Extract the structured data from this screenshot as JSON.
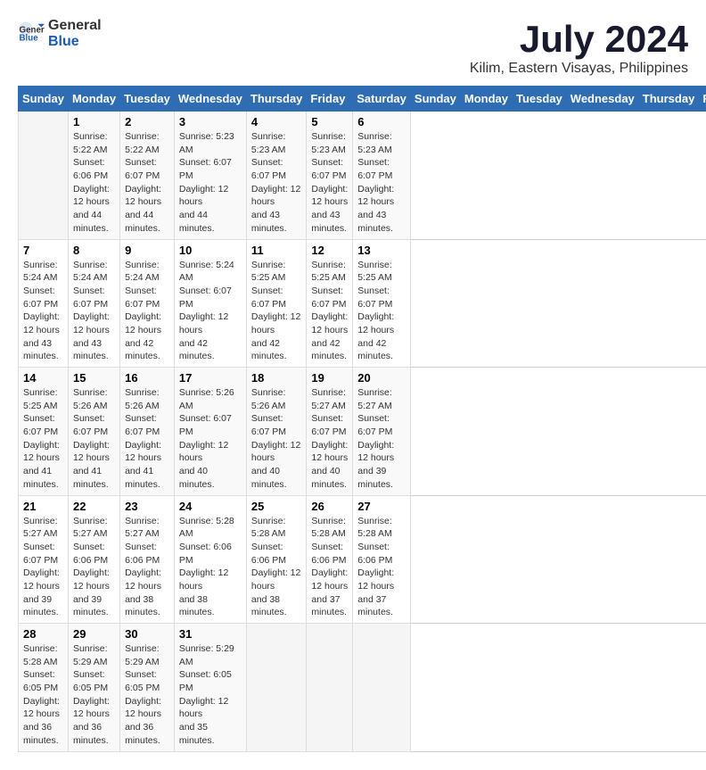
{
  "header": {
    "logo_general": "General",
    "logo_blue": "Blue",
    "month_year": "July 2024",
    "location": "Kilim, Eastern Visayas, Philippines"
  },
  "calendar": {
    "days_of_week": [
      "Sunday",
      "Monday",
      "Tuesday",
      "Wednesday",
      "Thursday",
      "Friday",
      "Saturday"
    ],
    "weeks": [
      [
        {
          "day": "",
          "info": ""
        },
        {
          "day": "1",
          "info": "Sunrise: 5:22 AM\nSunset: 6:06 PM\nDaylight: 12 hours\nand 44 minutes."
        },
        {
          "day": "2",
          "info": "Sunrise: 5:22 AM\nSunset: 6:07 PM\nDaylight: 12 hours\nand 44 minutes."
        },
        {
          "day": "3",
          "info": "Sunrise: 5:23 AM\nSunset: 6:07 PM\nDaylight: 12 hours\nand 44 minutes."
        },
        {
          "day": "4",
          "info": "Sunrise: 5:23 AM\nSunset: 6:07 PM\nDaylight: 12 hours\nand 43 minutes."
        },
        {
          "day": "5",
          "info": "Sunrise: 5:23 AM\nSunset: 6:07 PM\nDaylight: 12 hours\nand 43 minutes."
        },
        {
          "day": "6",
          "info": "Sunrise: 5:23 AM\nSunset: 6:07 PM\nDaylight: 12 hours\nand 43 minutes."
        }
      ],
      [
        {
          "day": "7",
          "info": "Sunrise: 5:24 AM\nSunset: 6:07 PM\nDaylight: 12 hours\nand 43 minutes."
        },
        {
          "day": "8",
          "info": "Sunrise: 5:24 AM\nSunset: 6:07 PM\nDaylight: 12 hours\nand 43 minutes."
        },
        {
          "day": "9",
          "info": "Sunrise: 5:24 AM\nSunset: 6:07 PM\nDaylight: 12 hours\nand 42 minutes."
        },
        {
          "day": "10",
          "info": "Sunrise: 5:24 AM\nSunset: 6:07 PM\nDaylight: 12 hours\nand 42 minutes."
        },
        {
          "day": "11",
          "info": "Sunrise: 5:25 AM\nSunset: 6:07 PM\nDaylight: 12 hours\nand 42 minutes."
        },
        {
          "day": "12",
          "info": "Sunrise: 5:25 AM\nSunset: 6:07 PM\nDaylight: 12 hours\nand 42 minutes."
        },
        {
          "day": "13",
          "info": "Sunrise: 5:25 AM\nSunset: 6:07 PM\nDaylight: 12 hours\nand 42 minutes."
        }
      ],
      [
        {
          "day": "14",
          "info": "Sunrise: 5:25 AM\nSunset: 6:07 PM\nDaylight: 12 hours\nand 41 minutes."
        },
        {
          "day": "15",
          "info": "Sunrise: 5:26 AM\nSunset: 6:07 PM\nDaylight: 12 hours\nand 41 minutes."
        },
        {
          "day": "16",
          "info": "Sunrise: 5:26 AM\nSunset: 6:07 PM\nDaylight: 12 hours\nand 41 minutes."
        },
        {
          "day": "17",
          "info": "Sunrise: 5:26 AM\nSunset: 6:07 PM\nDaylight: 12 hours\nand 40 minutes."
        },
        {
          "day": "18",
          "info": "Sunrise: 5:26 AM\nSunset: 6:07 PM\nDaylight: 12 hours\nand 40 minutes."
        },
        {
          "day": "19",
          "info": "Sunrise: 5:27 AM\nSunset: 6:07 PM\nDaylight: 12 hours\nand 40 minutes."
        },
        {
          "day": "20",
          "info": "Sunrise: 5:27 AM\nSunset: 6:07 PM\nDaylight: 12 hours\nand 39 minutes."
        }
      ],
      [
        {
          "day": "21",
          "info": "Sunrise: 5:27 AM\nSunset: 6:07 PM\nDaylight: 12 hours\nand 39 minutes."
        },
        {
          "day": "22",
          "info": "Sunrise: 5:27 AM\nSunset: 6:06 PM\nDaylight: 12 hours\nand 39 minutes."
        },
        {
          "day": "23",
          "info": "Sunrise: 5:27 AM\nSunset: 6:06 PM\nDaylight: 12 hours\nand 38 minutes."
        },
        {
          "day": "24",
          "info": "Sunrise: 5:28 AM\nSunset: 6:06 PM\nDaylight: 12 hours\nand 38 minutes."
        },
        {
          "day": "25",
          "info": "Sunrise: 5:28 AM\nSunset: 6:06 PM\nDaylight: 12 hours\nand 38 minutes."
        },
        {
          "day": "26",
          "info": "Sunrise: 5:28 AM\nSunset: 6:06 PM\nDaylight: 12 hours\nand 37 minutes."
        },
        {
          "day": "27",
          "info": "Sunrise: 5:28 AM\nSunset: 6:06 PM\nDaylight: 12 hours\nand 37 minutes."
        }
      ],
      [
        {
          "day": "28",
          "info": "Sunrise: 5:28 AM\nSunset: 6:05 PM\nDaylight: 12 hours\nand 36 minutes."
        },
        {
          "day": "29",
          "info": "Sunrise: 5:29 AM\nSunset: 6:05 PM\nDaylight: 12 hours\nand 36 minutes."
        },
        {
          "day": "30",
          "info": "Sunrise: 5:29 AM\nSunset: 6:05 PM\nDaylight: 12 hours\nand 36 minutes."
        },
        {
          "day": "31",
          "info": "Sunrise: 5:29 AM\nSunset: 6:05 PM\nDaylight: 12 hours\nand 35 minutes."
        },
        {
          "day": "",
          "info": ""
        },
        {
          "day": "",
          "info": ""
        },
        {
          "day": "",
          "info": ""
        }
      ]
    ]
  }
}
